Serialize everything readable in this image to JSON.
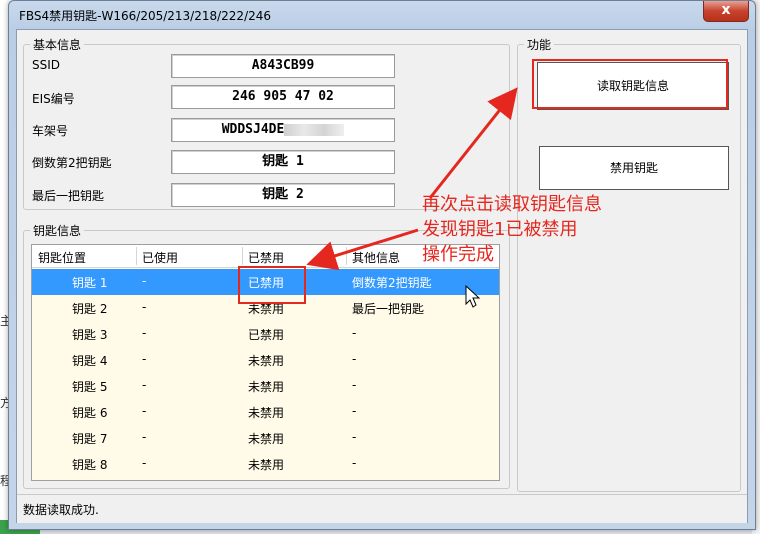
{
  "window": {
    "title": "FBS4禁用钥匙-W166/205/213/218/222/246",
    "close_symbol": "x"
  },
  "background": {
    "left_chars": [
      "主",
      "方",
      "程"
    ]
  },
  "basic_info": {
    "legend": "基本信息",
    "fields": [
      {
        "label": "SSID",
        "value": "A843CB99"
      },
      {
        "label": "EIS编号",
        "value": "246 905 47 02"
      },
      {
        "label": "车架号",
        "value": "WDDSJ4DE"
      },
      {
        "label": "倒数第2把钥匙",
        "value": "钥匙 1"
      },
      {
        "label": "最后一把钥匙",
        "value": "钥匙 2"
      }
    ]
  },
  "function_group": {
    "legend": "功能",
    "read_button": "读取钥匙信息",
    "disable_button": "禁用钥匙"
  },
  "key_info": {
    "legend": "钥匙信息",
    "columns": [
      "钥匙位置",
      "已使用",
      "已禁用",
      "其他信息"
    ],
    "rows": [
      {
        "position": "钥匙 1",
        "used": "-",
        "disabled": "已禁用",
        "other": "倒数第2把钥匙"
      },
      {
        "position": "钥匙 2",
        "used": "-",
        "disabled": "未禁用",
        "other": "最后一把钥匙"
      },
      {
        "position": "钥匙 3",
        "used": "-",
        "disabled": "已禁用",
        "other": "-"
      },
      {
        "position": "钥匙 4",
        "used": "-",
        "disabled": "未禁用",
        "other": "-"
      },
      {
        "position": "钥匙 5",
        "used": "-",
        "disabled": "未禁用",
        "other": "-"
      },
      {
        "position": "钥匙 6",
        "used": "-",
        "disabled": "未禁用",
        "other": "-"
      },
      {
        "position": "钥匙 7",
        "used": "-",
        "disabled": "未禁用",
        "other": "-"
      },
      {
        "position": "钥匙 8",
        "used": "-",
        "disabled": "未禁用",
        "other": "-"
      }
    ],
    "selected_row": 0
  },
  "status_bar": {
    "text": "数据读取成功."
  },
  "annotation": {
    "lines": [
      "再次点击读取钥匙信息",
      "发现钥匙1已被禁用",
      "操作完成"
    ],
    "color": "#e5281f"
  },
  "colors": {
    "selection": "#3399ff",
    "list_background": "#fffbe8",
    "annotation_red": "#e5281f"
  }
}
